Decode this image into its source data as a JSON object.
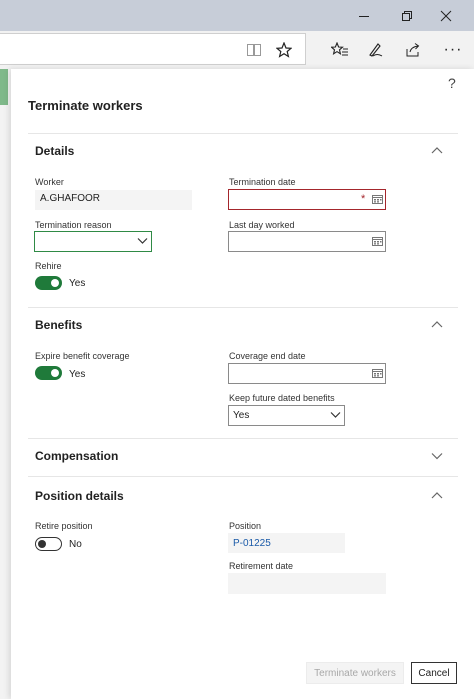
{
  "browser": {
    "reading_view_icon": "book-icon",
    "favorite_icon": "star-icon",
    "favorites_hub_icon": "star-list-icon",
    "notes_icon": "pen-icon",
    "share_icon": "share-icon",
    "more_label": "···"
  },
  "dialog": {
    "help_label": "?",
    "title": "Terminate workers",
    "sections": {
      "details": {
        "header": "Details",
        "worker_label": "Worker",
        "worker_value": "A.GHAFOOR",
        "termination_date_label": "Termination date",
        "termination_date_value": "",
        "required_marker": "*",
        "termination_reason_label": "Termination reason",
        "termination_reason_value": "",
        "last_day_worked_label": "Last day worked",
        "last_day_worked_value": "",
        "rehire_label": "Rehire",
        "rehire_state": "Yes"
      },
      "benefits": {
        "header": "Benefits",
        "expire_label": "Expire benefit coverage",
        "expire_state": "Yes",
        "coverage_end_label": "Coverage end date",
        "coverage_end_value": "",
        "keep_future_label": "Keep future dated benefits",
        "keep_future_value": "Yes"
      },
      "compensation": {
        "header": "Compensation"
      },
      "position": {
        "header": "Position details",
        "retire_label": "Retire position",
        "retire_state": "No",
        "position_label": "Position",
        "position_value": "P-01225",
        "retirement_date_label": "Retirement date",
        "retirement_date_value": ""
      }
    },
    "footer": {
      "terminate_label": "Terminate workers",
      "cancel_label": "Cancel"
    }
  },
  "colors": {
    "toggle_on": "#1f7a3a",
    "required_border": "#a4262c",
    "focus_border": "#2f8a45",
    "link": "#1a5aa8"
  }
}
